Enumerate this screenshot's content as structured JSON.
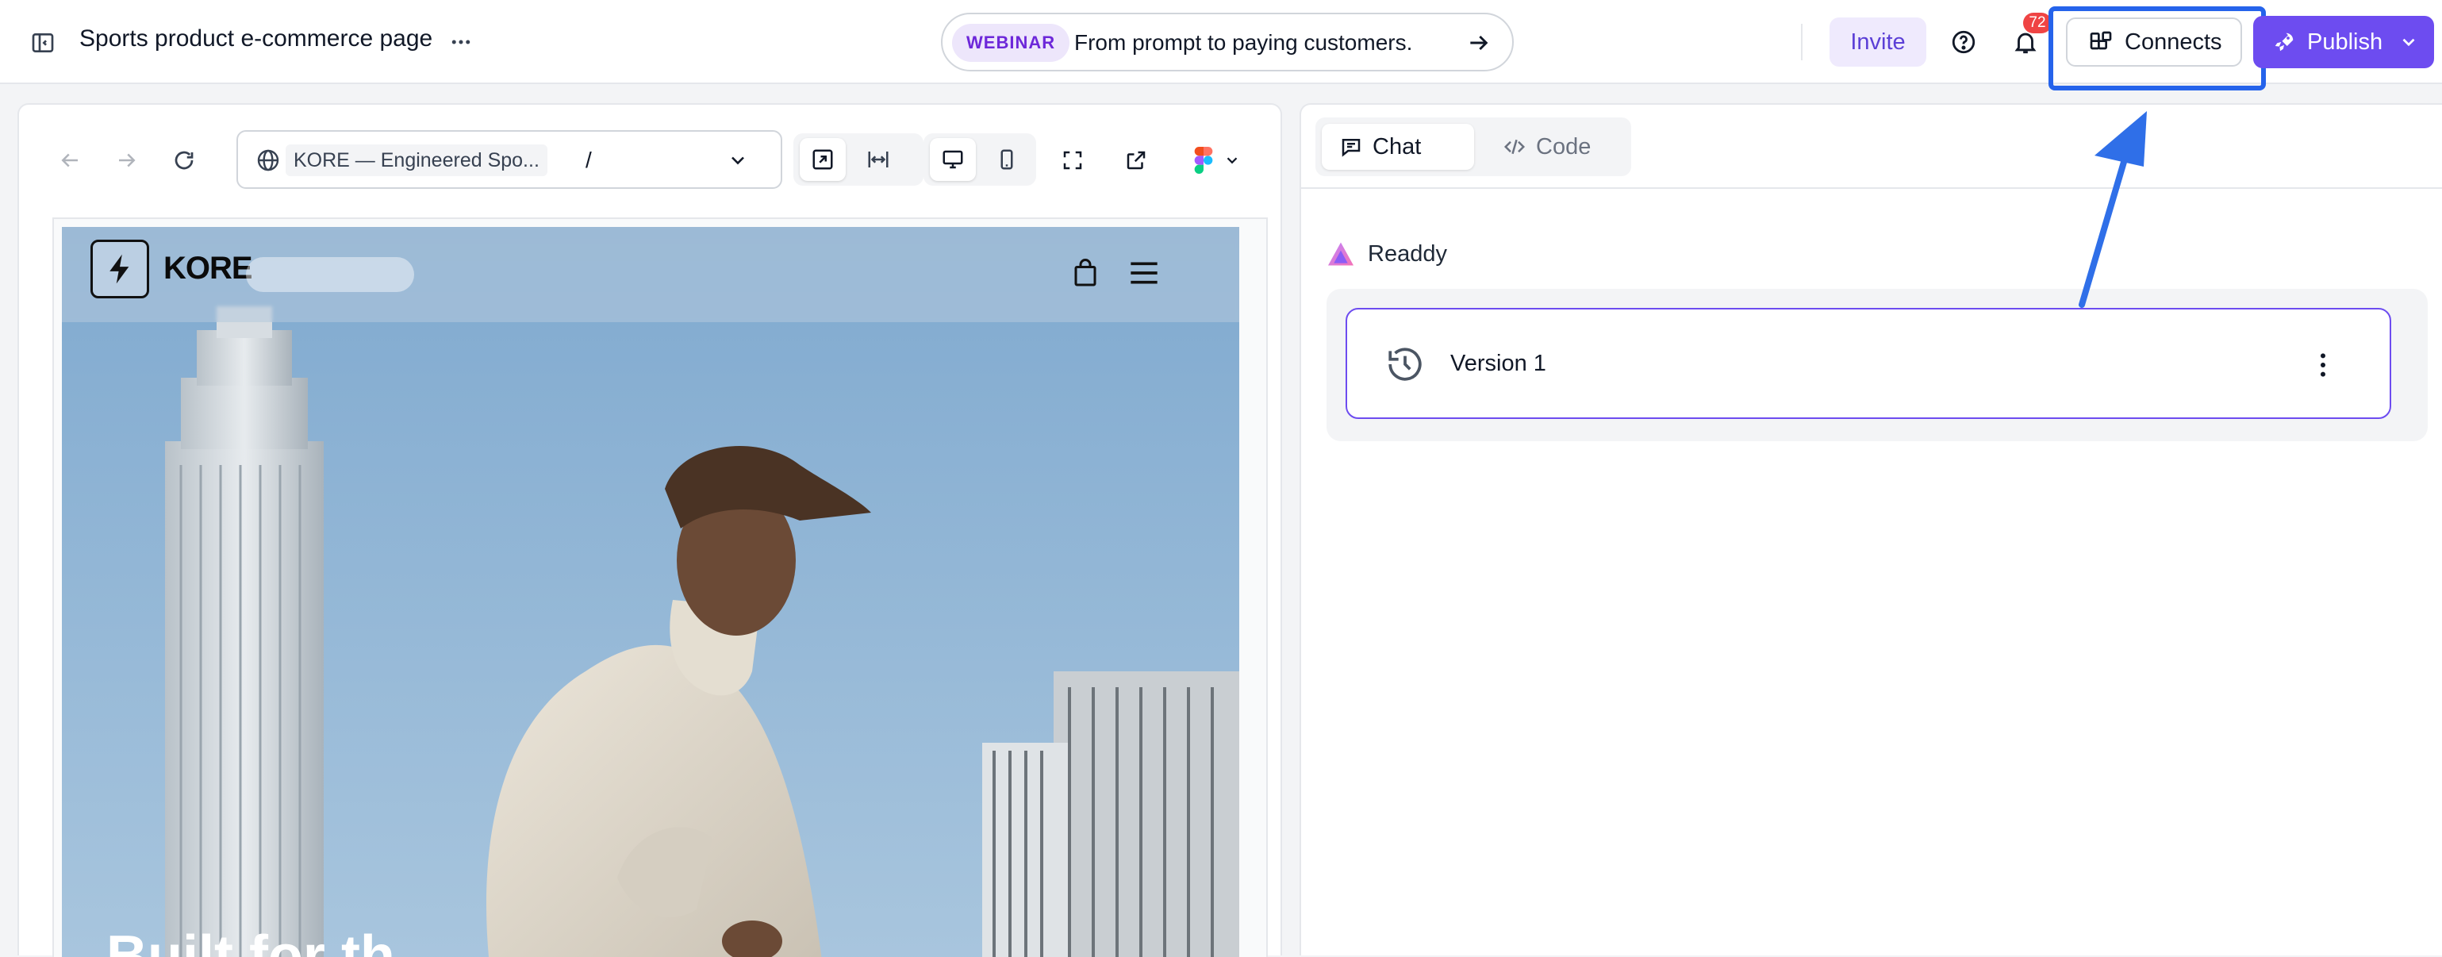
{
  "header": {
    "title": "Sports product e-commerce page",
    "webinar_badge": "WEBINAR",
    "webinar_text": "From prompt to paying customers.",
    "invite_label": "Invite",
    "notification_count": "72",
    "connects_label": "Connects",
    "publish_label": "Publish"
  },
  "preview": {
    "url_site": "KORE — Engineered Spo...",
    "url_path": "/",
    "site": {
      "brand": "KORE",
      "headline": "Built for th"
    }
  },
  "chat": {
    "tabs": [
      {
        "label": "Chat",
        "active": true
      },
      {
        "label": "Code",
        "active": false
      }
    ],
    "agent_name": "Readdy",
    "version_label": "Version 1"
  },
  "colors": {
    "accent": "#6d4cf0",
    "highlight": "#2563eb",
    "webinar_badge_bg": "#ede6fb",
    "notification": "#ef4444"
  }
}
